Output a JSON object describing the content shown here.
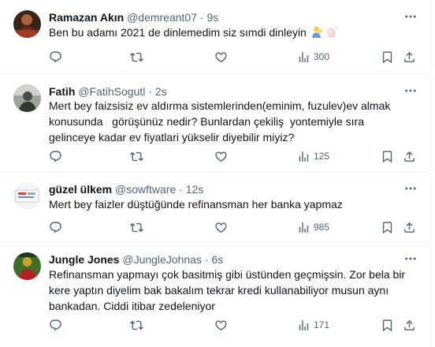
{
  "tweets": [
    {
      "name": "Ramazan Akın",
      "handle": "@demreant07",
      "sep": "·",
      "time": "9s",
      "text": "Ben bu adamı 2021 de dinlemedim siz sımdi dinleyin",
      "emojis": [
        "man-gesturing-icon",
        "clapping-hands-icon"
      ],
      "views": "300"
    },
    {
      "name": "Fatih",
      "handle": "@FatihSogutl",
      "sep": "·",
      "time": "2s",
      "text": "Mert bey faizsisiz ev aldırma sistemlerinden(eminim, fuzulev)ev almak konusunda   görüşünüz nedir? Bunlardan çekiliş  yontemiyle sıra gelinceye kadar ev fiyatlari yükselir diyebilir miyiz?",
      "views": "125"
    },
    {
      "name": "güzel ülkem",
      "handle": "@sowftware",
      "sep": "·",
      "time": "12s",
      "text": "Mert bey faizler düştüğünde refinansman her banka yapmaz",
      "views": "985"
    },
    {
      "name": "Jungle Jones",
      "handle": "@JungleJohnas",
      "sep": "·",
      "time": "6s",
      "text": "Refinansman yapmayı çok basitmiş gibi üstünden geçmişsin. Zor bela bir kere yaptın diyelim bak bakalım tekrar kredi kullanabiliyor musun aynı bankadan. Ciddi itibar zedeleniyor",
      "views": "171"
    }
  ],
  "icons": {
    "reply": "reply-icon",
    "retweet": "retweet-icon",
    "like": "like-icon",
    "views": "views-icon",
    "bookmark": "bookmark-icon",
    "share": "share-icon",
    "more": "more-icon"
  },
  "colors": {
    "text": "#0f1419",
    "secondary": "#536471",
    "divider": "#eff3f4"
  }
}
